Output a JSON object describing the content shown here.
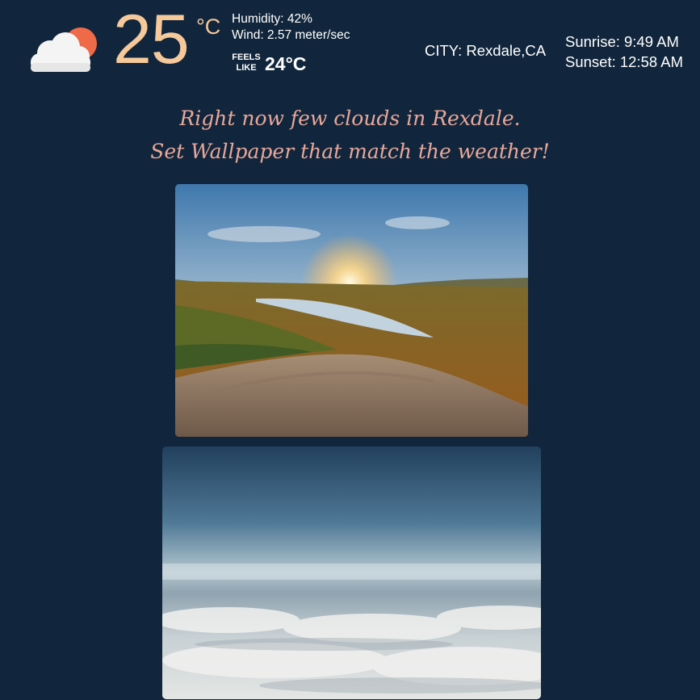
{
  "header": {
    "weather_icon": "partly-cloudy-icon",
    "temperature": "25",
    "temperature_unit": "°C",
    "humidity": "Humidity: 42%",
    "wind": "Wind: 2.57 meter/sec",
    "feels_like_label_1": "FEELS",
    "feels_like_label_2": "LIKE",
    "feels_like_value": "24°C",
    "city": "CITY: Rexdale,CA",
    "sunrise": "Sunrise: 9:49 AM",
    "sunset": "Sunset: 12:58 AM"
  },
  "message": {
    "line1": "Right now few clouds in Rexdale.",
    "line2": "Set Wallpaper that match the weather!"
  },
  "wallpapers": [
    {
      "subject": "sunset-lake-forest-wallpaper"
    },
    {
      "subject": "sky-above-clouds-wallpaper"
    }
  ],
  "colors": {
    "background": "#11263c",
    "temperature": "#f6c99a",
    "headline": "#e8a79a",
    "sun_icon": "#ee6a48"
  }
}
